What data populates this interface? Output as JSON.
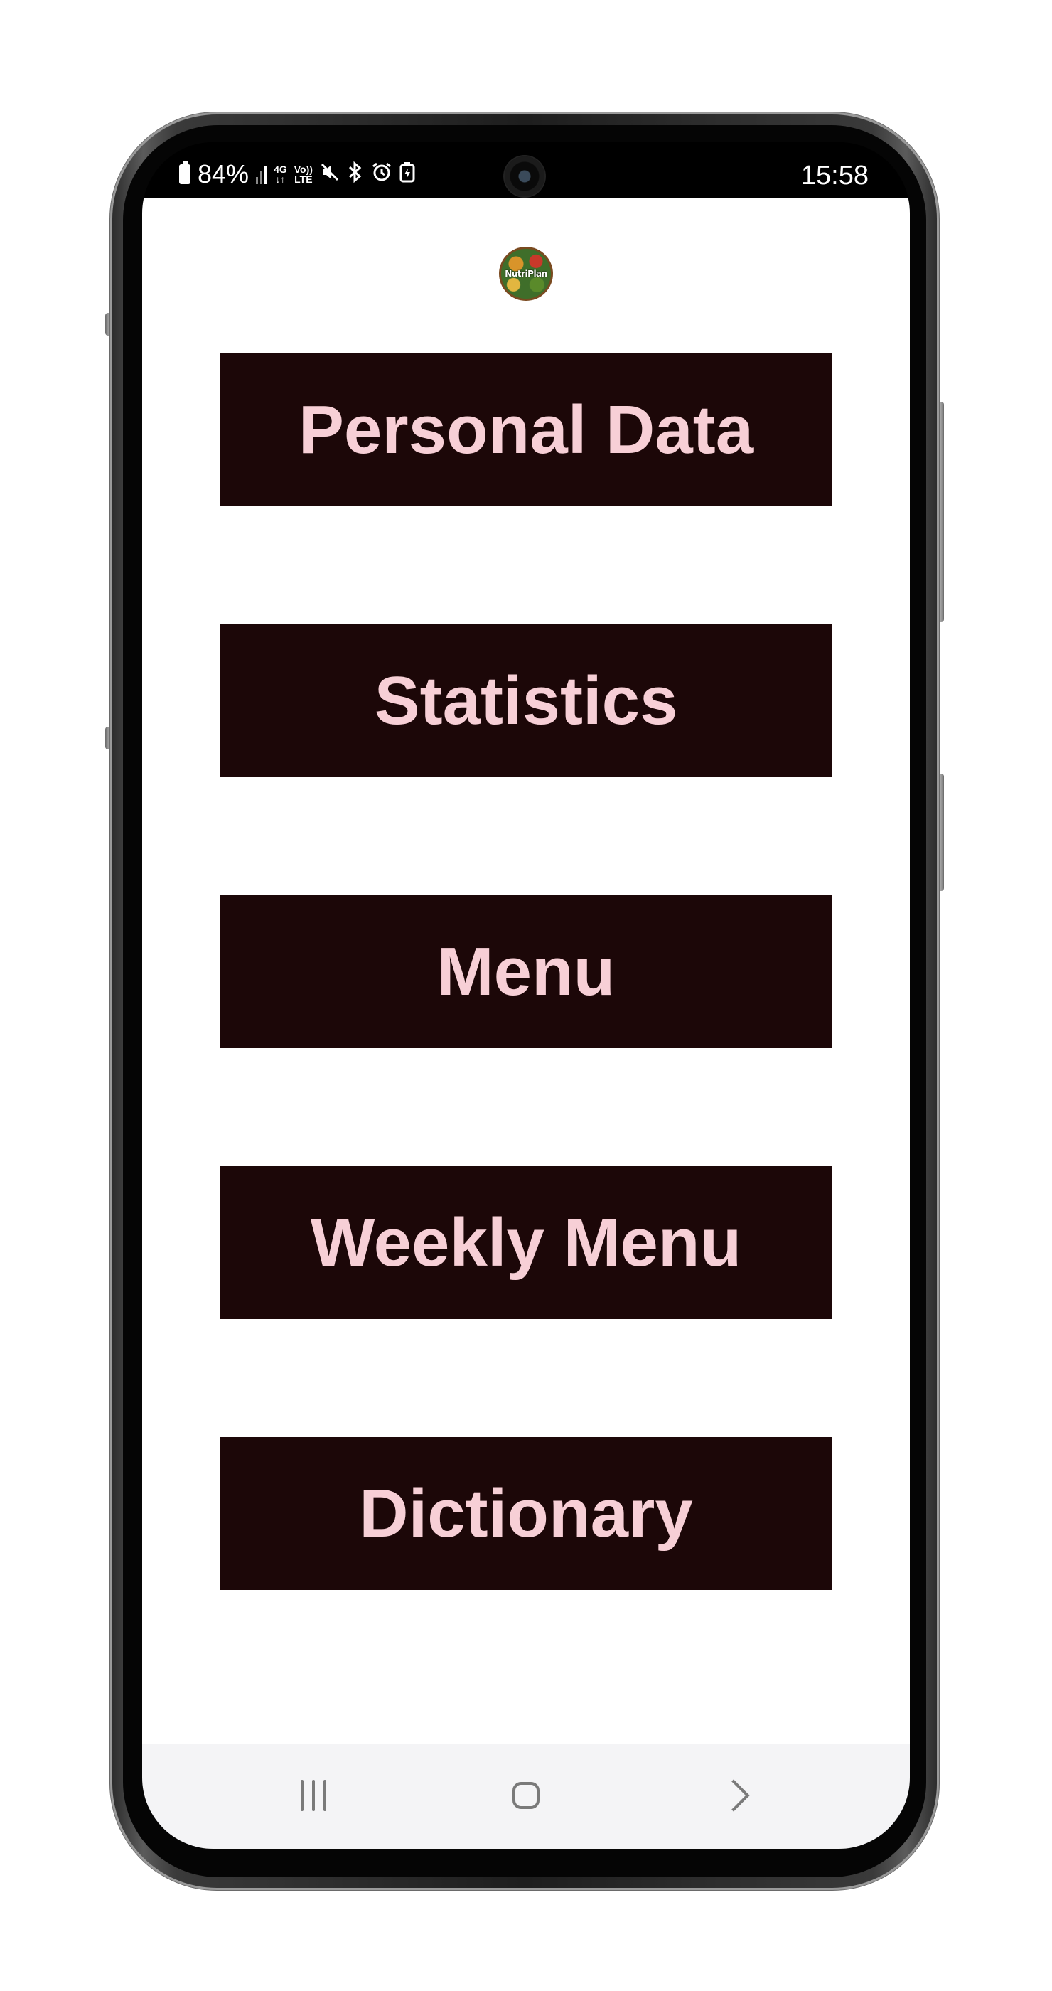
{
  "status_bar": {
    "battery_percent": "84%",
    "network_type": "4G",
    "volte_top": "Vo))",
    "volte_bottom": "LTE",
    "icons": [
      "battery-icon",
      "signal-icon",
      "network-4g-icon",
      "volte-icon",
      "mute-icon",
      "bluetooth-icon",
      "alarm-icon",
      "battery-saver-icon"
    ],
    "time": "15:58"
  },
  "app": {
    "logo_text": "NutriPlan",
    "buttons": [
      {
        "label": "Personal Data"
      },
      {
        "label": "Statistics"
      },
      {
        "label": "Menu"
      },
      {
        "label": "Weekly Menu"
      },
      {
        "label": "Dictionary"
      }
    ],
    "colors": {
      "button_background": "#1c0708",
      "button_text": "#f7cfd6",
      "page_background": "#ffffff"
    }
  },
  "navigation_bar": {
    "icons": [
      "recents-icon",
      "home-icon",
      "back-icon"
    ]
  }
}
